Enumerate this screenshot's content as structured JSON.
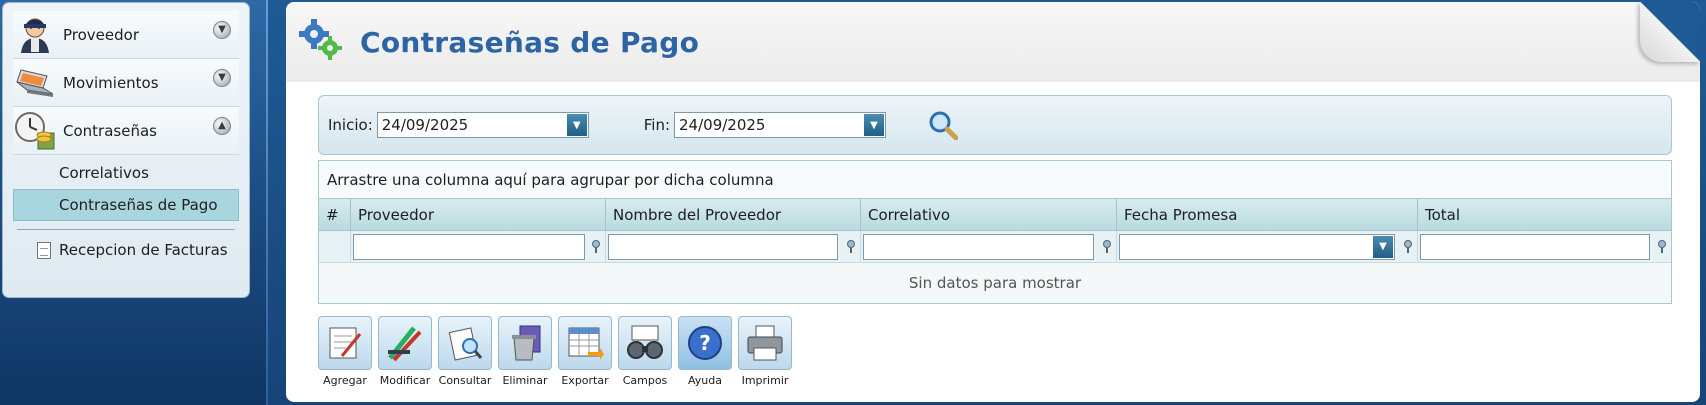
{
  "sidebar": {
    "groups": [
      {
        "label": "Proveedor",
        "icon": "person-icon",
        "arrow": "down"
      },
      {
        "label": "Movimientos",
        "icon": "laptop-icon",
        "arrow": "down"
      },
      {
        "label": "Contraseñas",
        "icon": "clock-coins-icon",
        "arrow": "up"
      }
    ],
    "items": [
      {
        "label": "Correlativos",
        "selected": false
      },
      {
        "label": "Contraseñas de Pago",
        "selected": true
      }
    ],
    "footer_item": {
      "label": "Recepcion de Facturas",
      "icon": "document-icon"
    }
  },
  "page": {
    "title": "Contraseñas de Pago",
    "title_icon": "gears-icon"
  },
  "filters": {
    "start_label": "Inicio:",
    "start_value": "24/09/2025",
    "end_label": "Fin:",
    "end_value": "24/09/2025",
    "search_icon": "magnifier-icon"
  },
  "grid": {
    "group_panel_text": "Arrastre una columna aquí para agrupar por dicha columna",
    "columns": [
      "#",
      "Proveedor",
      "Nombre del Proveedor",
      "Correlativo",
      "Fecha Promesa",
      "Total"
    ],
    "empty_text": "Sin datos para mostrar"
  },
  "toolbar": {
    "buttons": [
      {
        "label": "Agregar",
        "icon": "add-document-icon"
      },
      {
        "label": "Modificar",
        "icon": "pencils-icon"
      },
      {
        "label": "Consultar",
        "icon": "inspect-document-icon"
      },
      {
        "label": "Eliminar",
        "icon": "trash-icon"
      },
      {
        "label": "Exportar",
        "icon": "spreadsheet-export-icon"
      },
      {
        "label": "Campos",
        "icon": "binoculars-icon"
      },
      {
        "label": "Ayuda",
        "icon": "help-icon"
      },
      {
        "label": "Imprimir",
        "icon": "printer-icon"
      }
    ]
  },
  "colors": {
    "title": "#2d64a4",
    "selected_item": "#a9d5de",
    "grid_header": "#b8dadf",
    "background": "#1c4f82"
  }
}
